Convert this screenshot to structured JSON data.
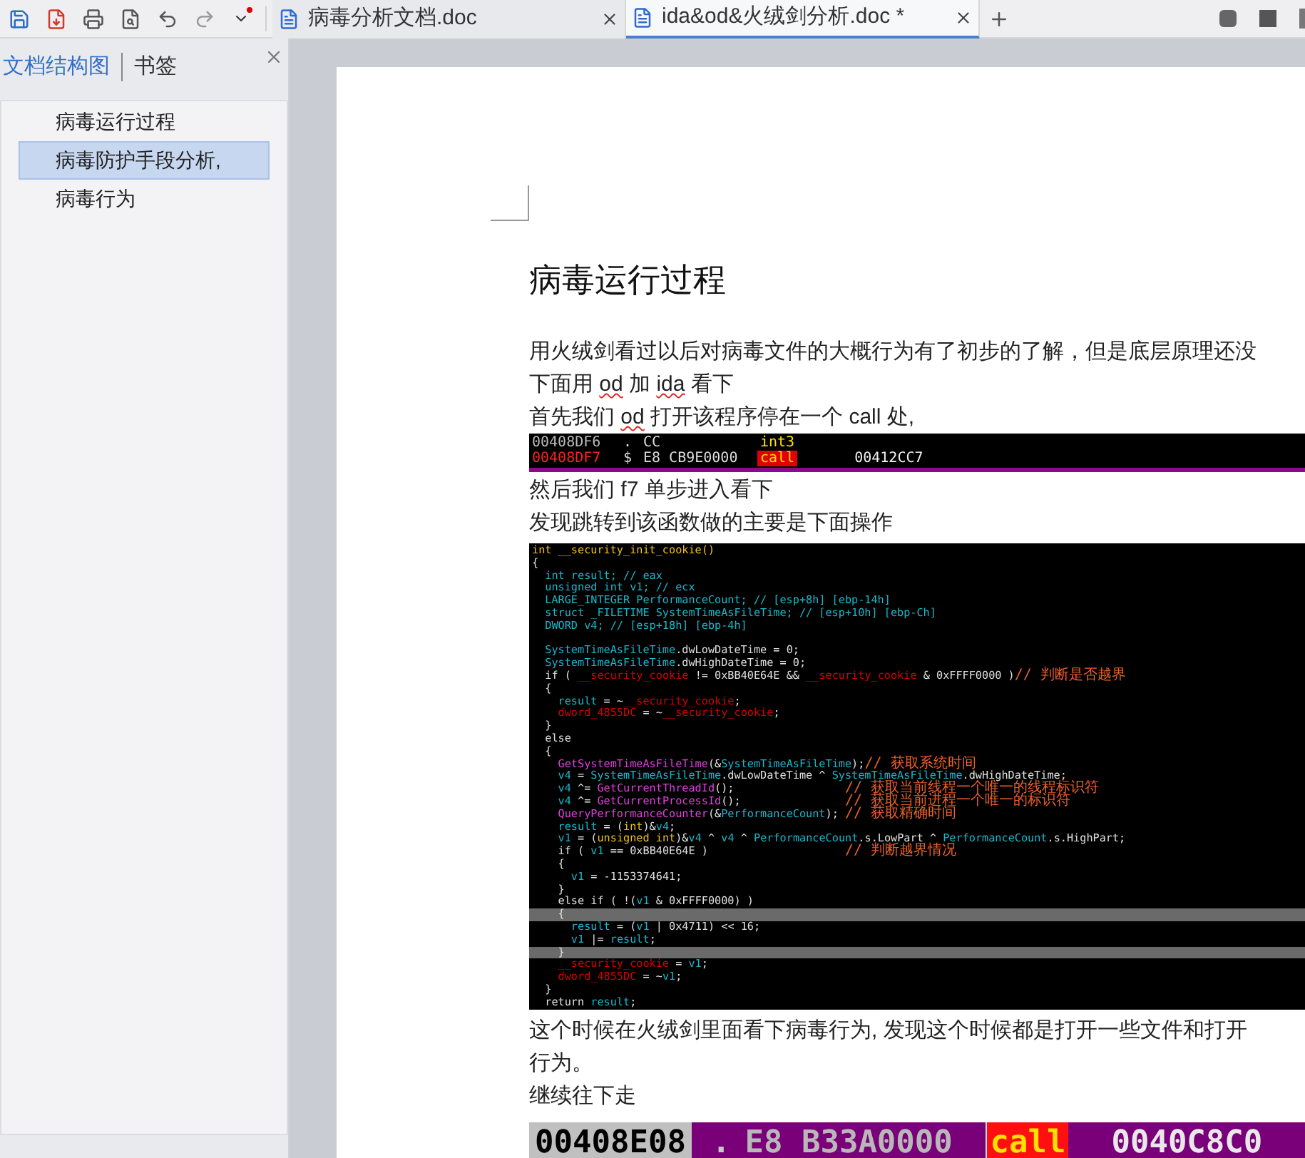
{
  "tabs": [
    {
      "label": "病毒分析文档.doc",
      "selected": false
    },
    {
      "label": "ida&od&火绒剑分析.doc *",
      "selected": true
    }
  ],
  "sidebar": {
    "tabs": [
      {
        "label": "文档结构图",
        "selected": true
      },
      {
        "label": "书签",
        "selected": false
      }
    ],
    "items": [
      {
        "label": "病毒运行过程",
        "selected": false
      },
      {
        "label": "病毒防护手段分析,",
        "selected": true
      },
      {
        "label": "病毒行为",
        "selected": false
      }
    ]
  },
  "document": [
    {
      "kind": "heading",
      "text": "病毒运行过程"
    },
    {
      "kind": "paragraph",
      "parts": [
        {
          "text": "用火绒剑看过以后对病毒文件的大概行为有了初步的了解，但是底层原理还没",
          "spellcheck": false
        }
      ]
    },
    {
      "kind": "paragraph",
      "parts": [
        {
          "text": "下面用 ",
          "spellcheck": false
        },
        {
          "text": "od",
          "spellcheck": true
        },
        {
          "text": " 加 ",
          "spellcheck": false
        },
        {
          "text": "ida",
          "spellcheck": true
        },
        {
          "text": " 看下",
          "spellcheck": false
        }
      ]
    },
    {
      "kind": "paragraph",
      "parts": [
        {
          "text": "首先我们 ",
          "spellcheck": false
        },
        {
          "text": "od",
          "spellcheck": true
        },
        {
          "text": " 打开该程序停在一个 call 处,",
          "spellcheck": false
        }
      ]
    },
    {
      "kind": "od_strip",
      "rows": [
        {
          "address": "00408DF6",
          "mark": ".",
          "bytes": "CC",
          "mnemonic": "int3",
          "operand": "",
          "current": false
        },
        {
          "address": "00408DF7",
          "mark": "$",
          "bytes": "E8 CB9E0000",
          "mnemonic": "call",
          "operand": "00412CC7",
          "current": true
        }
      ]
    },
    {
      "kind": "paragraph",
      "parts": [
        {
          "text": "然后我们 f7 单步进入看下",
          "spellcheck": false
        }
      ]
    },
    {
      "kind": "paragraph",
      "parts": [
        {
          "text": "发现跳转到该函数做的主要是下面操作",
          "spellcheck": false
        }
      ]
    },
    {
      "kind": "code",
      "lines": [
        {
          "highlighted": false,
          "tokens": [
            {
              "kind": "title",
              "text": "int __security_init_cookie()"
            }
          ]
        },
        {
          "highlighted": false,
          "tokens": [
            {
              "kind": "plain",
              "text": "{"
            }
          ]
        },
        {
          "highlighted": false,
          "tokens": [
            {
              "kind": "local",
              "text": "  int result; // eax"
            }
          ]
        },
        {
          "highlighted": false,
          "tokens": [
            {
              "kind": "local",
              "text": "  unsigned int v1; // ecx"
            }
          ]
        },
        {
          "highlighted": false,
          "tokens": [
            {
              "kind": "local",
              "text": "  LARGE_INTEGER PerformanceCount; // [esp+8h] [ebp-14h]"
            }
          ]
        },
        {
          "highlighted": false,
          "tokens": [
            {
              "kind": "local",
              "text": "  struct _FILETIME SystemTimeAsFileTime; // [esp+10h] [ebp-Ch]"
            }
          ]
        },
        {
          "highlighted": false,
          "tokens": [
            {
              "kind": "local",
              "text": "  DWORD v4; // [esp+18h] [ebp-4h]"
            }
          ]
        },
        {
          "highlighted": false
        },
        {
          "highlighted": false,
          "tokens": [
            {
              "kind": "local",
              "text": "  SystemTimeAsFileTime"
            },
            {
              "kind": "plain",
              "text": ".dwLowDateTime = 0;"
            }
          ]
        },
        {
          "highlighted": false,
          "tokens": [
            {
              "kind": "local",
              "text": "  SystemTimeAsFileTime"
            },
            {
              "kind": "plain",
              "text": ".dwHighDateTime = 0;"
            }
          ]
        },
        {
          "highlighted": false,
          "tokens": [
            {
              "kind": "plain",
              "text": "  if ( "
            },
            {
              "kind": "global",
              "text": "__security_cookie"
            },
            {
              "kind": "plain",
              "text": " != 0xBB40E64E && "
            },
            {
              "kind": "global",
              "text": "__security_cookie"
            },
            {
              "kind": "plain",
              "text": " & 0xFFFF0000 )"
            },
            {
              "kind": "comment",
              "text": "// 判断是否越界"
            }
          ]
        },
        {
          "highlighted": false,
          "tokens": [
            {
              "kind": "plain",
              "text": "  {"
            }
          ]
        },
        {
          "highlighted": false,
          "tokens": [
            {
              "kind": "local",
              "text": "    result"
            },
            {
              "kind": "plain",
              "text": " = ~"
            },
            {
              "kind": "global",
              "text": "__security_cookie"
            },
            {
              "kind": "plain",
              "text": ";"
            }
          ]
        },
        {
          "highlighted": false,
          "tokens": [
            {
              "kind": "global",
              "text": "    dword_4855DC"
            },
            {
              "kind": "plain",
              "text": " = ~"
            },
            {
              "kind": "global",
              "text": "__security_cookie"
            },
            {
              "kind": "plain",
              "text": ";"
            }
          ]
        },
        {
          "highlighted": false,
          "tokens": [
            {
              "kind": "plain",
              "text": "  }"
            }
          ]
        },
        {
          "highlighted": false,
          "tokens": [
            {
              "kind": "plain",
              "text": "  else"
            }
          ]
        },
        {
          "highlighted": false,
          "tokens": [
            {
              "kind": "plain",
              "text": "  {"
            }
          ]
        },
        {
          "highlighted": false,
          "tokens": [
            {
              "kind": "func",
              "text": "    GetSystemTimeAsFileTime"
            },
            {
              "kind": "plain",
              "text": "(&"
            },
            {
              "kind": "local",
              "text": "SystemTimeAsFileTime"
            },
            {
              "kind": "plain",
              "text": ");"
            },
            {
              "kind": "comment",
              "text": "// 获取系统时间"
            }
          ]
        },
        {
          "highlighted": false,
          "tokens": [
            {
              "kind": "local",
              "text": "    v4"
            },
            {
              "kind": "plain",
              "text": " = "
            },
            {
              "kind": "local",
              "text": "SystemTimeAsFileTime"
            },
            {
              "kind": "plain",
              "text": ".dwLowDateTime ^ "
            },
            {
              "kind": "local",
              "text": "SystemTimeAsFileTime"
            },
            {
              "kind": "plain",
              "text": ".dwHighDateTime;"
            }
          ]
        },
        {
          "highlighted": false,
          "tokens": [
            {
              "kind": "local",
              "text": "    v4"
            },
            {
              "kind": "plain",
              "text": " ^= "
            },
            {
              "kind": "func",
              "text": "GetCurrentThreadId"
            },
            {
              "kind": "plain",
              "text": "();                 "
            },
            {
              "kind": "comment",
              "text": "// 获取当前线程一个唯一的线程标识符"
            }
          ]
        },
        {
          "highlighted": false,
          "tokens": [
            {
              "kind": "local",
              "text": "    v4"
            },
            {
              "kind": "plain",
              "text": " ^= "
            },
            {
              "kind": "func",
              "text": "GetCurrentProcessId"
            },
            {
              "kind": "plain",
              "text": "();                "
            },
            {
              "kind": "comment",
              "text": "// 获取当前进程一个唯一的标识符"
            }
          ]
        },
        {
          "highlighted": false,
          "tokens": [
            {
              "kind": "func",
              "text": "    QueryPerformanceCounter"
            },
            {
              "kind": "plain",
              "text": "(&"
            },
            {
              "kind": "local",
              "text": "PerformanceCount"
            },
            {
              "kind": "plain",
              "text": "); "
            },
            {
              "kind": "comment",
              "text": "// 获取精确时间"
            }
          ]
        },
        {
          "highlighted": false,
          "tokens": [
            {
              "kind": "local",
              "text": "    result"
            },
            {
              "kind": "plain",
              "text": " = ("
            },
            {
              "kind": "type",
              "text": "int"
            },
            {
              "kind": "plain",
              "text": ")&"
            },
            {
              "kind": "local",
              "text": "v4"
            },
            {
              "kind": "plain",
              "text": ";"
            }
          ]
        },
        {
          "highlighted": false,
          "tokens": [
            {
              "kind": "local",
              "text": "    v1"
            },
            {
              "kind": "plain",
              "text": " = ("
            },
            {
              "kind": "type",
              "text": "unsigned int"
            },
            {
              "kind": "plain",
              "text": ")&"
            },
            {
              "kind": "local",
              "text": "v4"
            },
            {
              "kind": "plain",
              "text": " ^ "
            },
            {
              "kind": "local",
              "text": "v4"
            },
            {
              "kind": "plain",
              "text": " ^ "
            },
            {
              "kind": "local",
              "text": "PerformanceCount"
            },
            {
              "kind": "plain",
              "text": ".s.LowPart ^ "
            },
            {
              "kind": "local",
              "text": "PerformanceCount"
            },
            {
              "kind": "plain",
              "text": ".s.HighPart;"
            }
          ]
        },
        {
          "highlighted": false,
          "tokens": [
            {
              "kind": "plain",
              "text": "    if ( "
            },
            {
              "kind": "local",
              "text": "v1"
            },
            {
              "kind": "plain",
              "text": " == 0xBB40E64E )                     "
            },
            {
              "kind": "comment",
              "text": "// 判断越界情况"
            }
          ]
        },
        {
          "highlighted": false,
          "tokens": [
            {
              "kind": "plain",
              "text": "    {"
            }
          ]
        },
        {
          "highlighted": false,
          "tokens": [
            {
              "kind": "local",
              "text": "      v1"
            },
            {
              "kind": "plain",
              "text": " = -1153374641;"
            }
          ]
        },
        {
          "highlighted": false,
          "tokens": [
            {
              "kind": "plain",
              "text": "    }"
            }
          ]
        },
        {
          "highlighted": false,
          "tokens": [
            {
              "kind": "plain",
              "text": "    else if ( !("
            },
            {
              "kind": "local",
              "text": "v1"
            },
            {
              "kind": "plain",
              "text": " & 0xFFFF0000) )"
            }
          ]
        },
        {
          "highlighted": true,
          "tokens": [
            {
              "kind": "plain",
              "text": "    {"
            }
          ]
        },
        {
          "highlighted": false,
          "tokens": [
            {
              "kind": "local",
              "text": "      result"
            },
            {
              "kind": "plain",
              "text": " = ("
            },
            {
              "kind": "local",
              "text": "v1"
            },
            {
              "kind": "plain",
              "text": " | 0x4711) << 16;"
            }
          ]
        },
        {
          "highlighted": false,
          "tokens": [
            {
              "kind": "local",
              "text": "      v1"
            },
            {
              "kind": "plain",
              "text": " |= "
            },
            {
              "kind": "local",
              "text": "result"
            },
            {
              "kind": "plain",
              "text": ";"
            }
          ]
        },
        {
          "highlighted": true,
          "tokens": [
            {
              "kind": "plain",
              "text": "    }"
            }
          ]
        },
        {
          "highlighted": false,
          "tokens": [
            {
              "kind": "global",
              "text": "    __security_cookie"
            },
            {
              "kind": "plain",
              "text": " = "
            },
            {
              "kind": "local",
              "text": "v1"
            },
            {
              "kind": "plain",
              "text": ";"
            }
          ]
        },
        {
          "highlighted": false,
          "tokens": [
            {
              "kind": "global",
              "text": "    dword_4855DC"
            },
            {
              "kind": "plain",
              "text": " = ~"
            },
            {
              "kind": "local",
              "text": "v1"
            },
            {
              "kind": "plain",
              "text": ";"
            }
          ]
        },
        {
          "highlighted": false,
          "tokens": [
            {
              "kind": "plain",
              "text": "  }"
            }
          ]
        },
        {
          "highlighted": false,
          "tokens": [
            {
              "kind": "plain",
              "text": "  return "
            },
            {
              "kind": "local",
              "text": "result"
            },
            {
              "kind": "plain",
              "text": ";"
            }
          ]
        }
      ]
    },
    {
      "kind": "paragraph",
      "parts": [
        {
          "text": "这个时候在火绒剑里面看下病毒行为, 发现这个时候都是打开一些文件和打开",
          "spellcheck": false
        }
      ]
    },
    {
      "kind": "paragraph",
      "parts": [
        {
          "text": "行为。",
          "spellcheck": false
        }
      ]
    },
    {
      "kind": "paragraph",
      "parts": [
        {
          "text": "继续往下走",
          "spellcheck": false
        }
      ]
    },
    {
      "kind": "od_strip_large",
      "rows": [
        {
          "address": "00408E08",
          "mark": ".",
          "bytes": "E8 B33A0000",
          "mnemonic": "call",
          "operand": "0040C8C0",
          "current": true
        }
      ]
    }
  ]
}
